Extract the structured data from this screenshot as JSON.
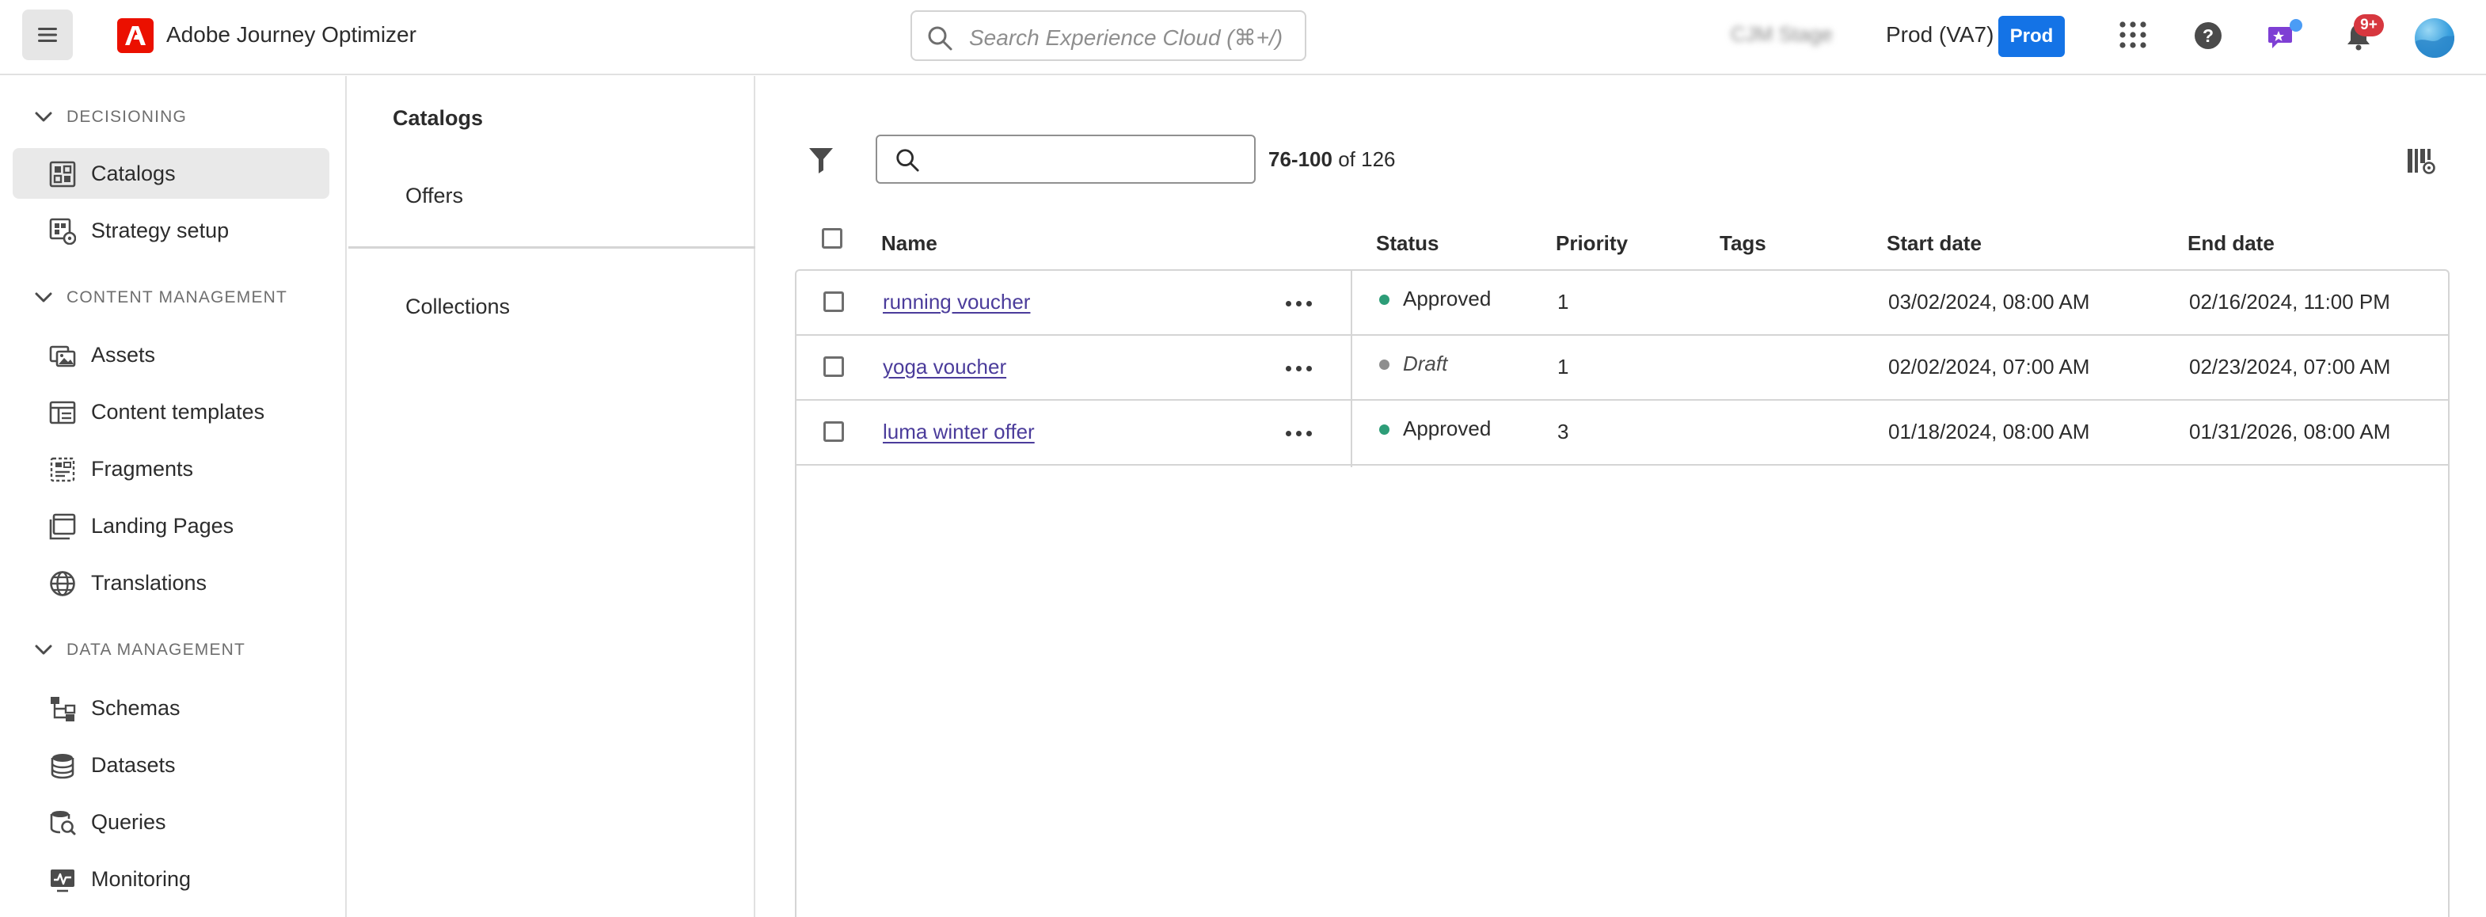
{
  "app": {
    "title": "Adobe Journey Optimizer",
    "brand_color": "#eb1000"
  },
  "header": {
    "search_placeholder": "Search Experience Cloud (⌘+/)",
    "org_name": "CJM Stage",
    "sandbox": "Prod (VA7)",
    "env_badge": "Prod",
    "env_badge_color": "#1473e6",
    "notifications_count": "9+",
    "icons": [
      "menu-icon",
      "adobe-logo-icon",
      "search-icon",
      "apps-grid-icon",
      "help-icon",
      "feedback-chat-icon",
      "notifications-bell-icon",
      "user-avatar"
    ]
  },
  "sidebar": {
    "sections": [
      {
        "label": "DECISIONING"
      },
      {
        "label": "CONTENT MANAGEMENT"
      },
      {
        "label": "DATA MANAGEMENT"
      }
    ],
    "items": [
      {
        "label": "Catalogs",
        "icon": "catalogs-icon",
        "active": true
      },
      {
        "label": "Strategy setup",
        "icon": "strategy-setup-icon"
      },
      {
        "label": "Assets",
        "icon": "assets-icon"
      },
      {
        "label": "Content templates",
        "icon": "content-templates-icon"
      },
      {
        "label": "Fragments",
        "icon": "fragments-icon"
      },
      {
        "label": "Landing Pages",
        "icon": "landing-pages-icon"
      },
      {
        "label": "Translations",
        "icon": "globe-icon"
      },
      {
        "label": "Schemas",
        "icon": "schemas-icon"
      },
      {
        "label": "Datasets",
        "icon": "datasets-icon"
      },
      {
        "label": "Queries",
        "icon": "queries-icon"
      },
      {
        "label": "Monitoring",
        "icon": "monitoring-icon"
      }
    ]
  },
  "subnav": {
    "title": "Catalogs",
    "items": [
      {
        "label": "Offers"
      },
      {
        "label": "Collections"
      }
    ]
  },
  "toolbar": {
    "range": "76-100",
    "total": "of 126"
  },
  "table": {
    "columns": [
      "Name",
      "Status",
      "Priority",
      "Tags",
      "Start date",
      "End date"
    ],
    "rows": [
      {
        "name": "running voucher",
        "status": "Approved",
        "status_color": "#2d9d78",
        "priority": "1",
        "tags": "",
        "start": "03/02/2024, 08:00 AM",
        "end": "02/16/2024, 11:00 PM"
      },
      {
        "name": "yoga voucher",
        "status": "Draft",
        "status_color": "#8e8e8e",
        "priority": "1",
        "tags": "",
        "start": "02/02/2024, 07:00 AM",
        "end": "02/23/2024, 07:00 AM"
      },
      {
        "name": "luma winter offer",
        "status": "Approved",
        "status_color": "#2d9d78",
        "priority": "3",
        "tags": "",
        "start": "01/18/2024, 08:00 AM",
        "end": "01/31/2026, 08:00 AM"
      }
    ]
  }
}
